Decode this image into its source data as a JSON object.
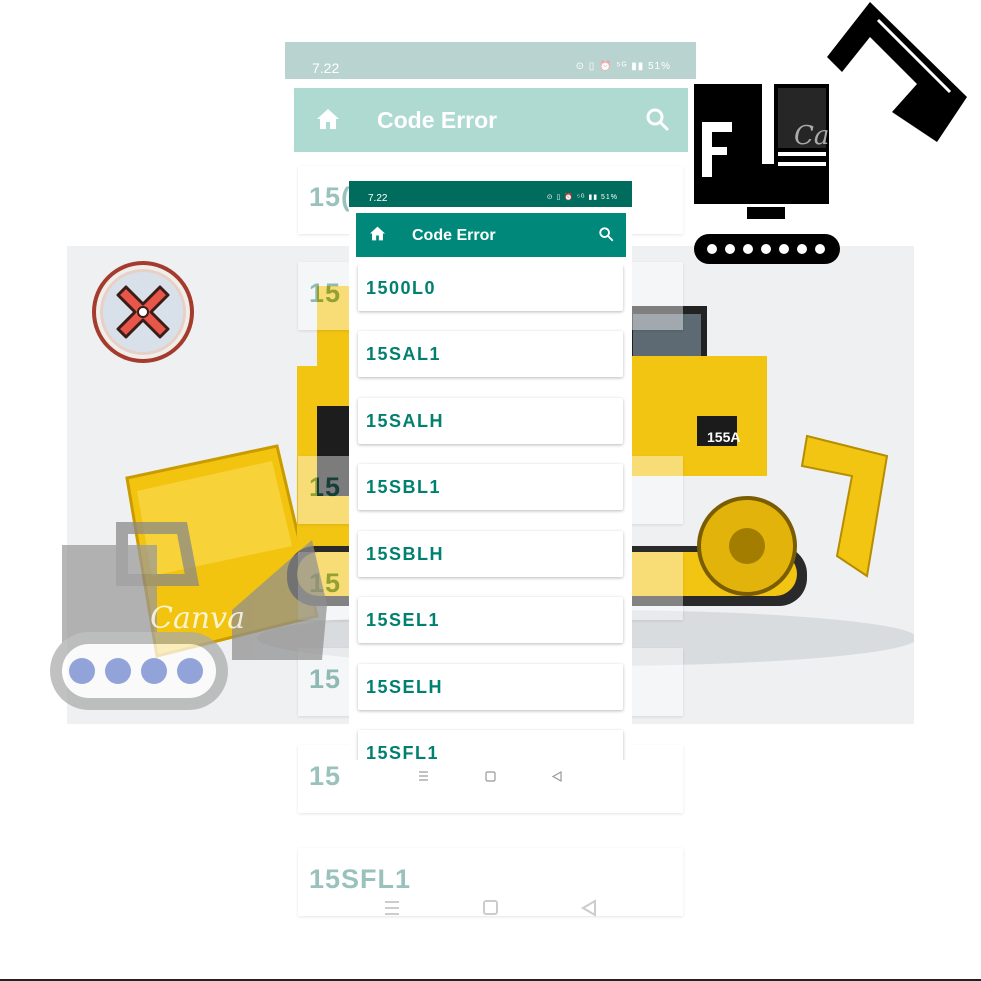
{
  "background_phone": {
    "status_time": "7.22",
    "status_icons": "⊙ ▯ ⏰ ⁵ᴳ ▮▮ 51%",
    "app_title": "Code Error",
    "list_items": [
      {
        "code": "15("
      },
      {
        "code": "15"
      },
      {
        "code": "15"
      },
      {
        "code": "15"
      },
      {
        "code": "15"
      },
      {
        "code": "15"
      },
      {
        "code": "15SFL1"
      }
    ]
  },
  "front_phone": {
    "status_time": "7.22",
    "status_icons": "⊙ ▯ ⏰ ⁵ᴳ ▮▮ 51%",
    "app_title": "Code Error",
    "list_items": [
      {
        "code": "1500L0"
      },
      {
        "code": "15SAL1"
      },
      {
        "code": "15SALH"
      },
      {
        "code": "15SBL1"
      },
      {
        "code": "15SBLH"
      },
      {
        "code": "15SEL1"
      },
      {
        "code": "15SELH"
      },
      {
        "code": "15SFL1"
      }
    ]
  },
  "watermarks": {
    "bulldozer": "Canva",
    "excavator": "Ca"
  },
  "colors": {
    "front_appbar": "#00897b",
    "front_status": "#006c5e",
    "list_text": "#00806f",
    "bulldozer_yellow": "#f2c40f",
    "error_red": "#e8564a"
  }
}
